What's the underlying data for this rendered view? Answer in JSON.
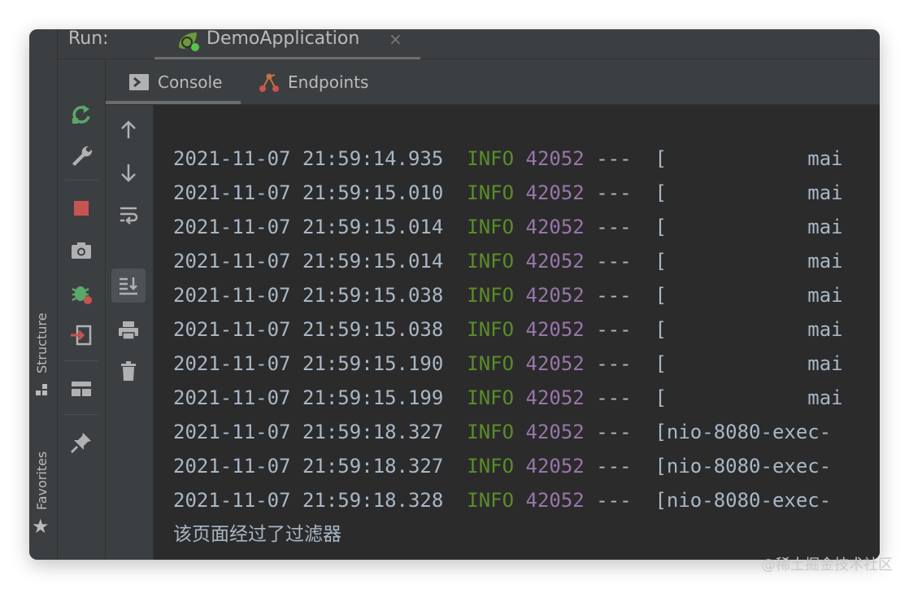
{
  "run_header": {
    "label": "Run:",
    "tab_label": "DemoApplication",
    "close_glyph": "×"
  },
  "tool_strip": {
    "structure_label": "Structure",
    "favorites_label": "Favorites",
    "star_glyph": "★"
  },
  "action_icons": [
    "rerun-icon",
    "wrench-icon",
    "stop-icon",
    "camera-icon",
    "debug-bug-icon",
    "exit-icon",
    "layout-icon",
    "pin-icon"
  ],
  "console_tabs": [
    {
      "label": "Console",
      "icon": "console-icon",
      "active": true
    },
    {
      "label": "Endpoints",
      "icon": "endpoints-icon",
      "active": false
    }
  ],
  "console_tools": [
    "arrow-up-icon",
    "arrow-down-icon",
    "soft-wrap-icon",
    "scroll-to-end-icon",
    "print-icon",
    "trash-icon"
  ],
  "colors": {
    "accent_green": "#59a869",
    "stop_red": "#c75450",
    "level_green": "#5b8c2a",
    "pid_purple": "#9876aa",
    "text": "#a9b7c6"
  },
  "log_lines": [
    {
      "timestamp": "2021-11-07 21:59:14.935",
      "level": "INFO",
      "pid": "42052",
      "thread": " ---  [            mai"
    },
    {
      "timestamp": "2021-11-07 21:59:15.010",
      "level": "INFO",
      "pid": "42052",
      "thread": " ---  [            mai"
    },
    {
      "timestamp": "2021-11-07 21:59:15.014",
      "level": "INFO",
      "pid": "42052",
      "thread": " ---  [            mai"
    },
    {
      "timestamp": "2021-11-07 21:59:15.014",
      "level": "INFO",
      "pid": "42052",
      "thread": " ---  [            mai"
    },
    {
      "timestamp": "2021-11-07 21:59:15.038",
      "level": "INFO",
      "pid": "42052",
      "thread": " ---  [            mai"
    },
    {
      "timestamp": "2021-11-07 21:59:15.038",
      "level": "INFO",
      "pid": "42052",
      "thread": " ---  [            mai"
    },
    {
      "timestamp": "2021-11-07 21:59:15.190",
      "level": "INFO",
      "pid": "42052",
      "thread": " ---  [            mai"
    },
    {
      "timestamp": "2021-11-07 21:59:15.199",
      "level": "INFO",
      "pid": "42052",
      "thread": " ---  [            mai"
    },
    {
      "timestamp": "2021-11-07 21:59:18.327",
      "level": "INFO",
      "pid": "42052",
      "thread": " ---  [nio-8080-exec-"
    },
    {
      "timestamp": "2021-11-07 21:59:18.327",
      "level": "INFO",
      "pid": "42052",
      "thread": " ---  [nio-8080-exec-"
    },
    {
      "timestamp": "2021-11-07 21:59:18.328",
      "level": "INFO",
      "pid": "42052",
      "thread": " ---  [nio-8080-exec-"
    }
  ],
  "plain_output": "该页面经过了过滤器",
  "watermark": "@稀土掘金技术社区"
}
